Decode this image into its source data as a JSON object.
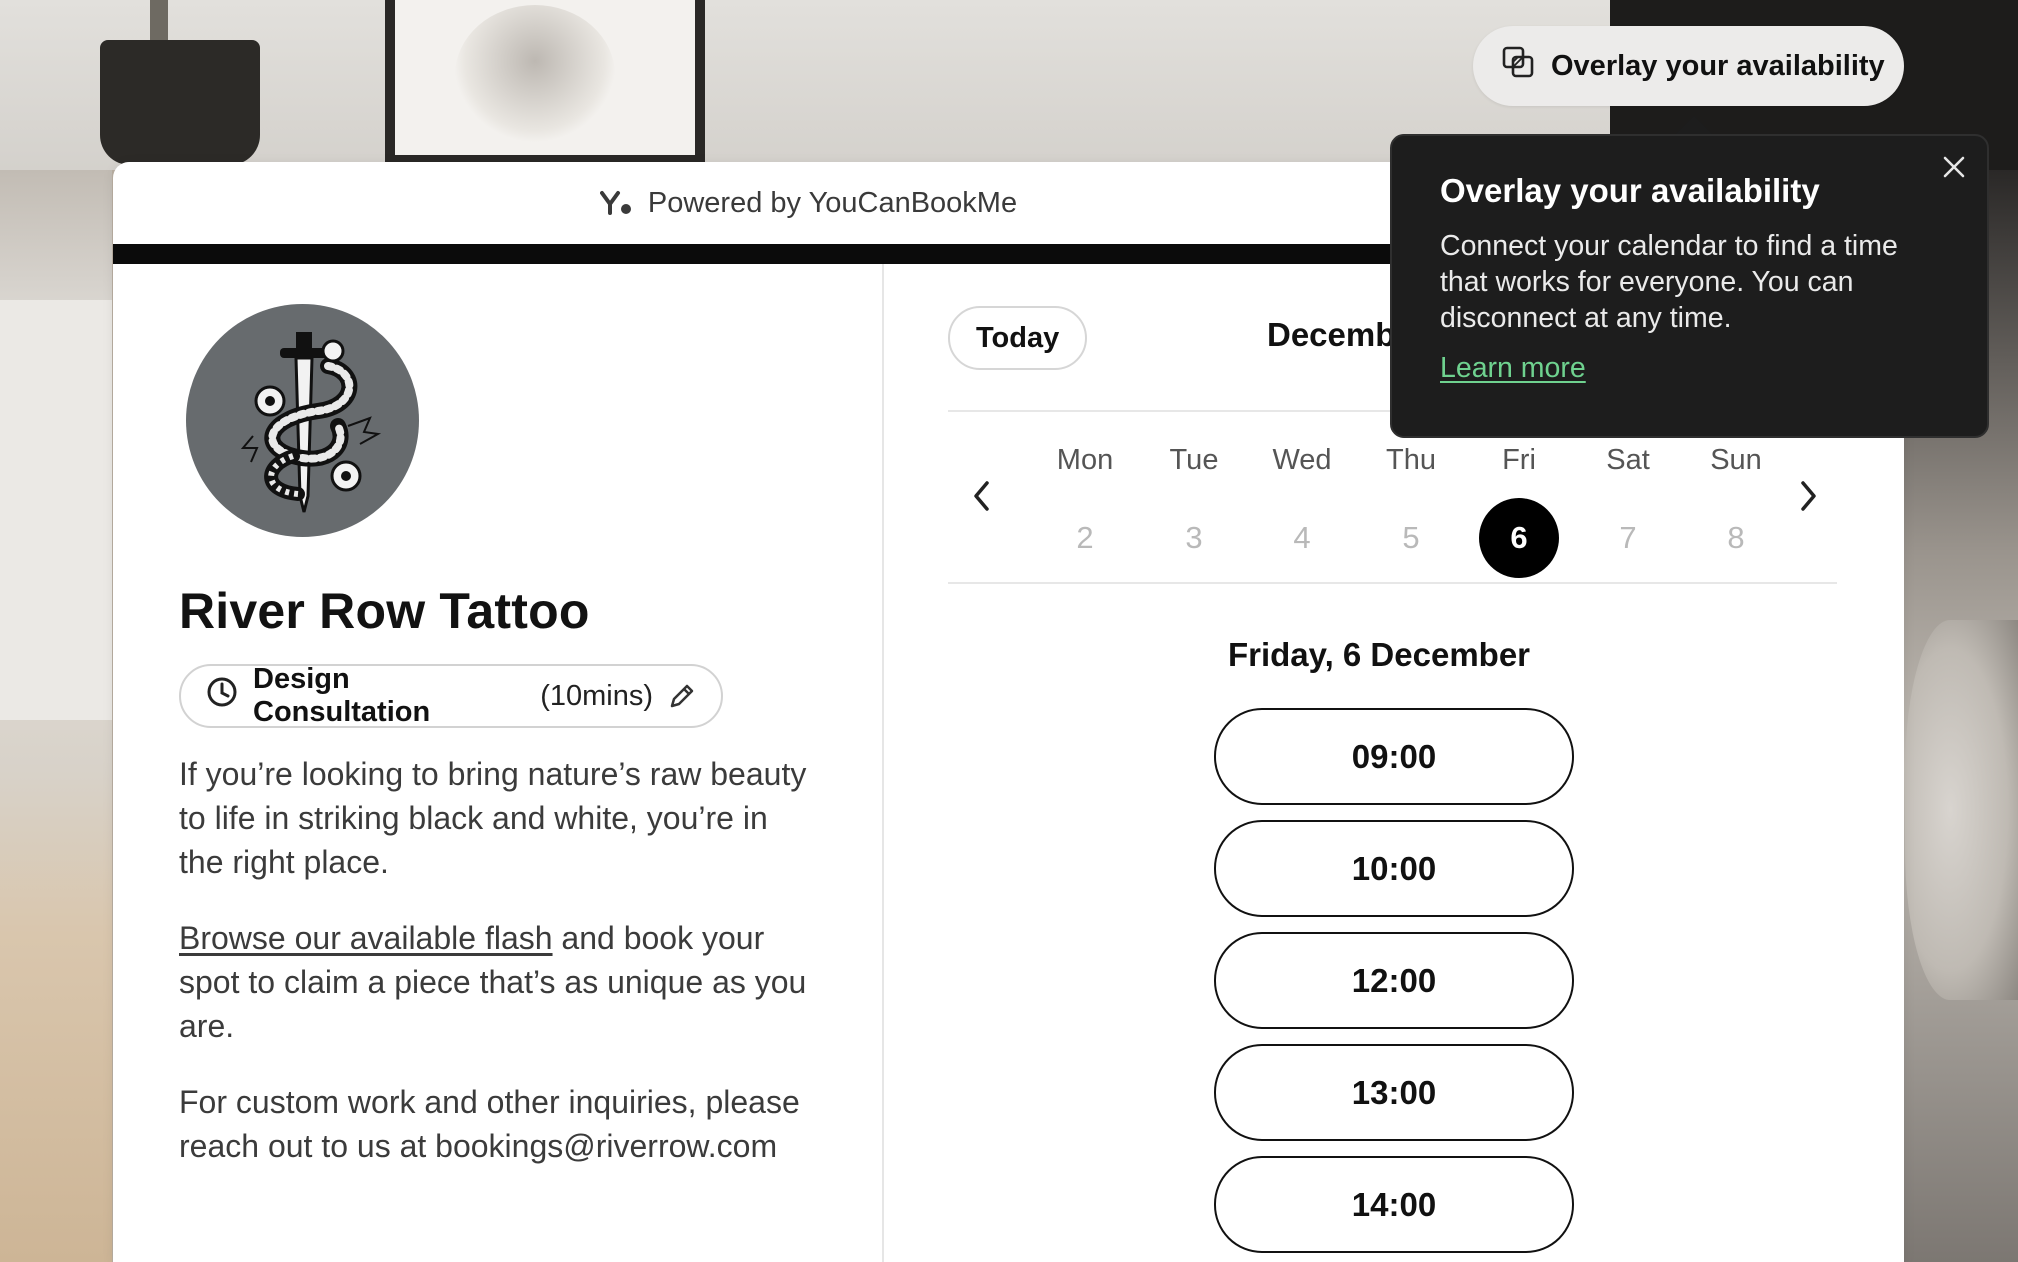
{
  "header": {
    "powered_by": "Powered by YouCanBookMe"
  },
  "profile": {
    "business_name": "River Row Tattoo",
    "event_title": "Design Consultation",
    "event_duration": "(10mins)",
    "desc_p1": "If you’re looking to bring nature’s raw beauty to life in striking black and white, you’re in the right place.",
    "desc_p2_link": "Browse our available flash",
    "desc_p2_rest": " and book your spot to claim a piece that’s as unique as you are.",
    "desc_p3": "For custom work and other inquiries, please reach out to us at bookings@riverrow.com"
  },
  "calendar": {
    "today_label": "Today",
    "month_label": "Decemb",
    "days": [
      {
        "name": "Mon",
        "num": "2"
      },
      {
        "name": "Tue",
        "num": "3"
      },
      {
        "name": "Wed",
        "num": "4"
      },
      {
        "name": "Thu",
        "num": "5"
      },
      {
        "name": "Fri",
        "num": "6"
      },
      {
        "name": "Sat",
        "num": "7"
      },
      {
        "name": "Sun",
        "num": "8"
      }
    ],
    "selected_day": "Fri",
    "date_heading": "Friday, 6 December",
    "slots": [
      "09:00",
      "10:00",
      "12:00",
      "13:00",
      "14:00"
    ]
  },
  "overlay": {
    "button_label": "Overlay your availability",
    "popover_title": "Overlay your availability",
    "popover_body": "Connect your calendar to find a time that works for everyone. You can disconnect at any time.",
    "popover_link": "Learn more"
  },
  "colors": {
    "accent_link": "#6fd28f",
    "selected_day_bg": "#000000",
    "popover_bg": "#1d1d1d"
  },
  "icons": {
    "powered": "youcanbookme-logo-icon",
    "clock": "clock-icon",
    "edit": "pencil-icon",
    "prev": "chevron-left-icon",
    "next": "chevron-right-icon",
    "overlay": "overlay-squares-icon",
    "close": "close-icon"
  }
}
